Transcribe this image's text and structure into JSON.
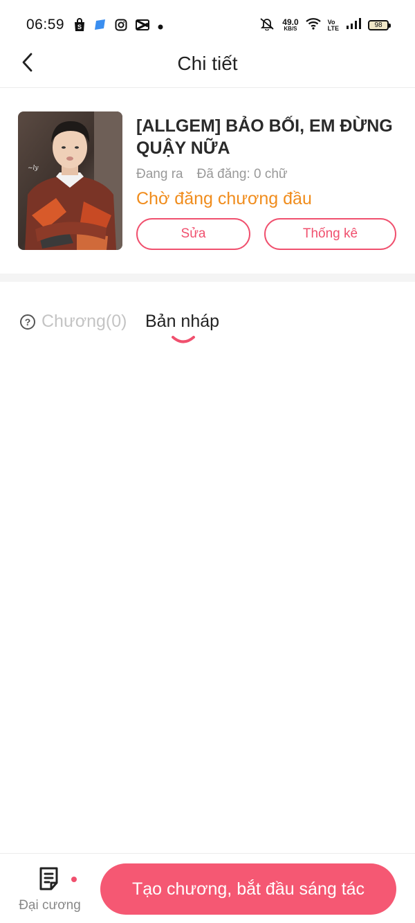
{
  "status_bar": {
    "time": "06:59",
    "net_speed_value": "49.0",
    "net_speed_unit": "KB/S",
    "volte_top": "Vo",
    "volte_bottom": "LTE",
    "battery": "98",
    "left_icons": [
      "shopee-bag-icon",
      "messenger-icon",
      "instagram-icon",
      "capcut-icon",
      "dot-icon"
    ],
    "right_icons": [
      "mute-bell-icon",
      "wifi-icon",
      "volte-icon",
      "signal-icon",
      "battery-icon"
    ]
  },
  "header": {
    "title": "Chi tiết",
    "back_icon": "chevron-left-icon"
  },
  "book": {
    "title": "[ALLGEM] BẢO BỐI, EM ĐỪNG QUẬY NỮA",
    "status_label": "Đang ra",
    "posted_label": "Đã đăng: 0 chữ",
    "publish_status": "Chờ đăng chương đầu",
    "edit_label": "Sửa",
    "stats_label": "Thống kê"
  },
  "tabs": {
    "chapters_label": "Chương(0)",
    "drafts_label": "Bản nháp",
    "help_icon": "?"
  },
  "bottom_bar": {
    "outline_label": "Đại cương",
    "create_label": "Tạo chương, bắt đầu sáng tác"
  },
  "colors": {
    "accent": "#f55873",
    "outline_accent": "#f0506e",
    "status_orange": "#f08c1c",
    "muted_text": "#999999"
  }
}
